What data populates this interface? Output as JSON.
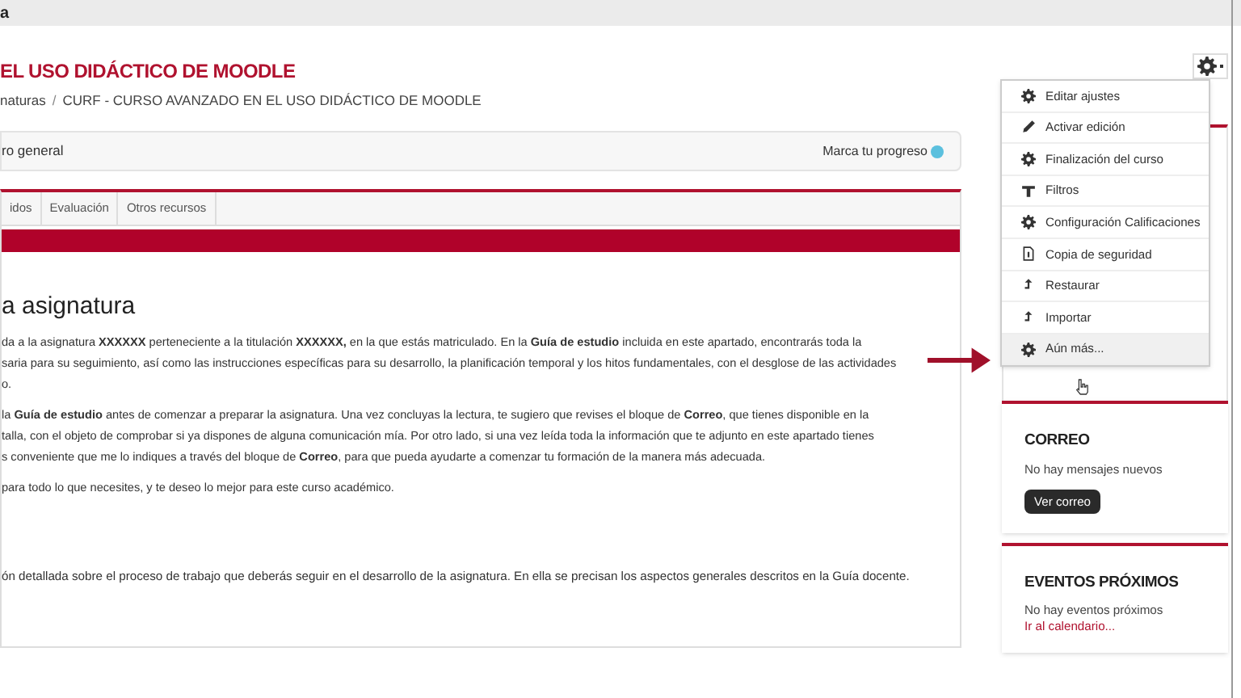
{
  "top_bar": {
    "text": "a"
  },
  "page_title": "EL USO DIDÁCTICO DE MOODLE",
  "breadcrumb": [
    "naturas",
    "CURF - CURSO AVANZADO EN EL USO DIDÁCTICO DE MOODLE"
  ],
  "breadcrumb_separator": "/",
  "section_bar": {
    "title": "ro general",
    "progress_label": "Marca tu progreso"
  },
  "tabs": [
    {
      "label": "idos",
      "selected": false
    },
    {
      "label": "Evaluación",
      "selected": false
    },
    {
      "label": "Otros recursos",
      "selected": false
    }
  ],
  "content": {
    "heading": "a asignatura",
    "paragraphs": [
      [
        "da a la asignatura **XXXXXX** perteneciente a la titulación **XXXXXX,** en la que estás matriculado. En la **Guía de estudio** incluida en este apartado, encontrarás toda la",
        "saria para su seguimiento, así como las instrucciones específicas para su desarrollo, la planificación temporal y los hitos fundamentales, con el desglose de las actividades",
        "o."
      ],
      [
        "la **Guía de estudio** antes de comenzar a preparar la asignatura. Una vez concluyas la lectura, te sugiero que revises el bloque de **Correo**, que tienes disponible en la",
        "talla, con el objeto de comprobar si ya dispones de alguna comunicación mía. Por otro lado, si una vez leída toda la información que te adjunto en este apartado tienes",
        "s conveniente que me lo indiques a través del bloque de **Correo**, para que pueda ayudarte a comenzar tu formación de la manera más adecuada."
      ],
      [
        "para todo lo que necesites, y te deseo lo mejor para este curso académico."
      ]
    ],
    "detail": "ón detallada sobre el proceso de trabajo que deberás seguir en el desarrollo de la asignatura. En ella se precisan los aspectos generales descritos en la Guía docente."
  },
  "settings_menu": [
    {
      "kind": "gear",
      "label": "Editar ajustes",
      "highlighted": false
    },
    {
      "kind": "pencil",
      "label": "Activar edición",
      "highlighted": false
    },
    {
      "kind": "gear",
      "label": "Finalización del curso",
      "highlighted": false
    },
    {
      "kind": "filter",
      "label": "Filtros",
      "highlighted": false
    },
    {
      "kind": "gear",
      "label": "Configuración Calificaciones",
      "highlighted": false
    },
    {
      "kind": "file",
      "label": "Copia de seguridad",
      "highlighted": false
    },
    {
      "kind": "upload",
      "label": "Restaurar",
      "highlighted": false
    },
    {
      "kind": "upload",
      "label": "Importar",
      "highlighted": false
    },
    {
      "kind": "gear",
      "label": "Aún más...",
      "highlighted": true
    }
  ],
  "mail_block": {
    "title": "CORREO",
    "message": "No hay mensajes nuevos",
    "button": "Ver correo"
  },
  "events_block": {
    "title": "EVENTOS PRÓXIMOS",
    "message": "No hay eventos próximos",
    "link": "Ir al calendario..."
  }
}
